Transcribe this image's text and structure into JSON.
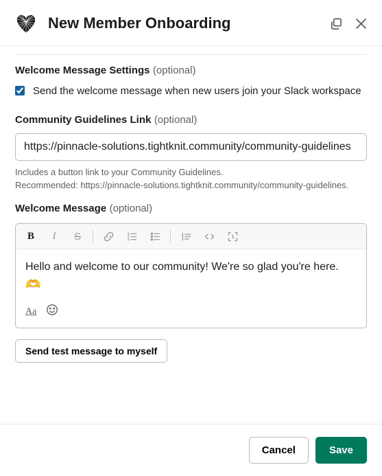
{
  "header": {
    "title": "New Member Onboarding"
  },
  "welcome_settings": {
    "label": "Welcome Message Settings",
    "optional": "(optional)",
    "checkbox_label": "Send the welcome message when new users join your Slack workspace",
    "checked": true
  },
  "guidelines": {
    "label": "Community Guidelines Link",
    "optional": "(optional)",
    "value": "https://pinnacle-solutions.tightknit.community/community-guidelines",
    "helper_line1": "Includes a button link to your Community Guidelines.",
    "helper_line2": "Recommended: https://pinnacle-solutions.tightknit.community/community-guidelines."
  },
  "welcome_msg": {
    "label": "Welcome Message",
    "optional": "(optional)",
    "body": "Hello and welcome to our community! We're so glad you're here.",
    "emoji": "🫶",
    "format_toggle": "Aa"
  },
  "actions": {
    "send_test": "Send test message to myself",
    "cancel": "Cancel",
    "save": "Save"
  }
}
